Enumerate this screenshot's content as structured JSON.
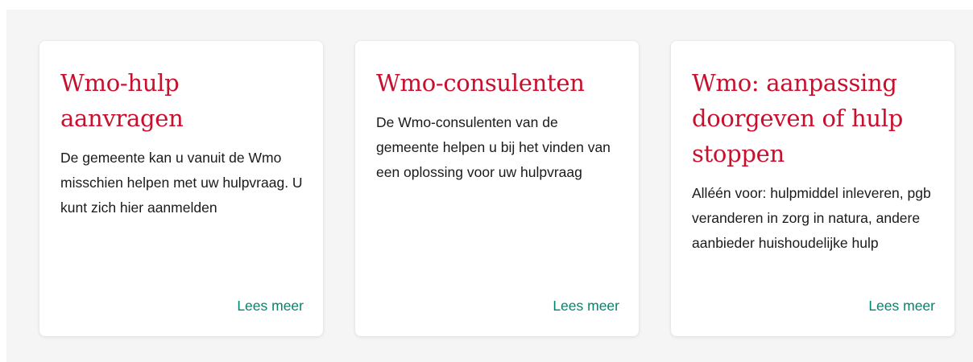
{
  "colors": {
    "title": "#c8102e",
    "link": "#00856f",
    "text": "#1a1a1a",
    "background": "#f5f5f5",
    "card": "#ffffff"
  },
  "cards": [
    {
      "title": "Wmo-hulp aanvragen",
      "text": "De gemeente kan u vanuit de Wmo misschien helpen met uw hulpvraag. U kunt zich hier aanmelden",
      "link": "Lees meer"
    },
    {
      "title": "Wmo-consulenten",
      "text": "De Wmo-consulenten van de gemeente helpen u bij het vinden van een oplossing voor uw hulpvraag",
      "link": "Lees meer"
    },
    {
      "title": "Wmo: aanpassing doorgeven of hulp stoppen",
      "text": "Alléén voor: hulpmiddel inleveren, pgb veranderen in zorg in natura, andere aanbieder huishoudelijke hulp",
      "link": "Lees meer"
    }
  ]
}
